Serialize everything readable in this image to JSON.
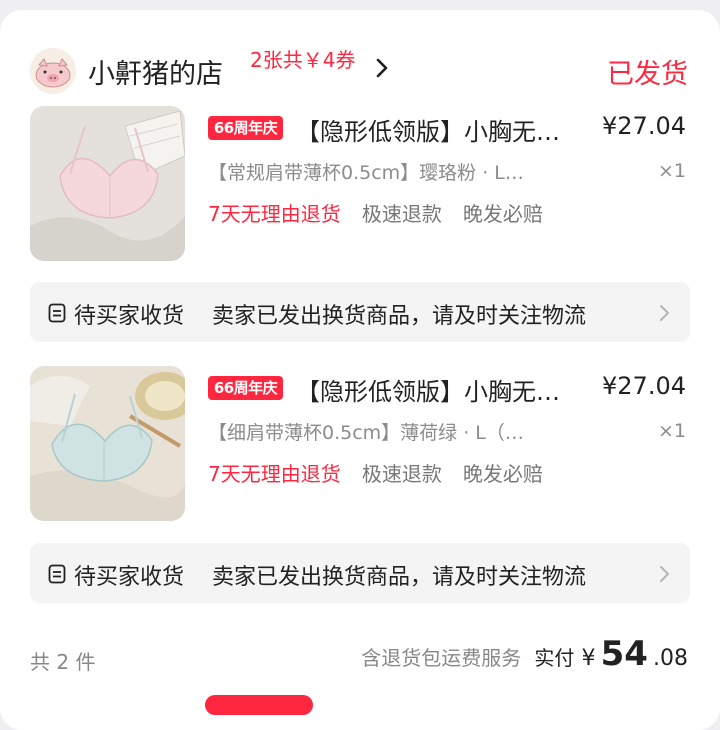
{
  "shop": {
    "name": "小鼾猪的店",
    "coupon": "2张共￥4券",
    "status": "已发货",
    "avatar_icon": "pig-avatar"
  },
  "items": [
    {
      "badge": "66周年庆",
      "title": "【隐形低领版】小胸无…",
      "price": "¥27.04",
      "spec": "【常规肩带薄杯0.5cm】璎珞粉 · L…",
      "qty": "×1",
      "tags": [
        "7天无理由退货",
        "极速退款",
        "晚发必赔"
      ],
      "thumb_color": "pink"
    },
    {
      "badge": "66周年庆",
      "title": "【隐形低领版】小胸无…",
      "price": "¥27.04",
      "spec": "【细肩带薄杯0.5cm】薄荷绿 · L（…",
      "qty": "×1",
      "tags": [
        "7天无理由退货",
        "极速退款",
        "晚发必赔"
      ],
      "thumb_color": "mint green"
    }
  ],
  "notices": [
    {
      "status": "待买家收货",
      "message": "卖家已发出换货商品，请及时关注物流"
    },
    {
      "status": "待买家收货",
      "message": "卖家已发出换货商品，请及时关注物流"
    }
  ],
  "footer": {
    "count": "共 2 件",
    "service": "含退货包运费服务",
    "paid_label": "实付",
    "currency": "¥",
    "amount_int": "54",
    "amount_dec": ".08"
  },
  "colors": {
    "accent": "#ff2740",
    "background": "#efeff1",
    "card": "#ffffff",
    "notice_bg": "#f4f4f5"
  }
}
